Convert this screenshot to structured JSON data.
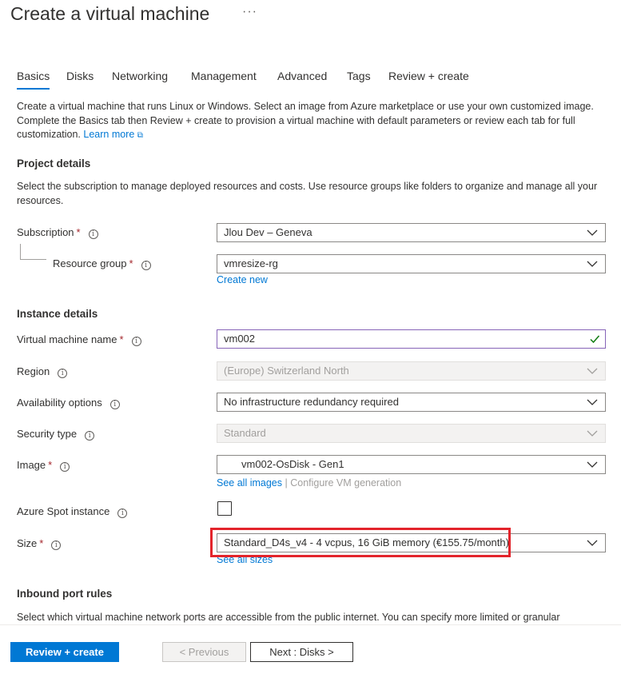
{
  "page": {
    "title": "Create a virtual machine",
    "more_glyph": "···"
  },
  "tabs": [
    "Basics",
    "Disks",
    "Networking",
    "Management",
    "Advanced",
    "Tags",
    "Review + create"
  ],
  "intro": {
    "text": "Create a virtual machine that runs Linux or Windows. Select an image from Azure marketplace or use your own customized image. Complete the Basics tab then Review + create to provision a virtual machine with default parameters or review each tab for full customization. ",
    "learn_more": "Learn more",
    "external_glyph": "⧉"
  },
  "project_details": {
    "heading": "Project details",
    "description": "Select the subscription to manage deployed resources and costs. Use resource groups like folders to organize and manage all your resources.",
    "subscription": {
      "label": "Subscription",
      "value": "Jlou Dev – Geneva"
    },
    "resource_group": {
      "label": "Resource group",
      "value": "vmresize-rg",
      "create_new": "Create new"
    }
  },
  "instance_details": {
    "heading": "Instance details",
    "vm_name": {
      "label": "Virtual machine name",
      "value": "vm002"
    },
    "region": {
      "label": "Region",
      "value": "(Europe) Switzerland North"
    },
    "availability": {
      "label": "Availability options",
      "value": "No infrastructure redundancy required"
    },
    "security_type": {
      "label": "Security type",
      "value": "Standard"
    },
    "image": {
      "label": "Image",
      "value": "vm002-OsDisk - Gen1",
      "see_all": "See all images",
      "separator": "|",
      "configure": "Configure VM generation"
    },
    "spot": {
      "label": "Azure Spot instance",
      "checked": false
    },
    "size": {
      "label": "Size",
      "value": "Standard_D4s_v4 - 4 vcpus, 16 GiB memory (€155.75/month)",
      "see_all": "See all sizes"
    }
  },
  "inbound": {
    "heading": "Inbound port rules",
    "description": "Select which virtual machine network ports are accessible from the public internet. You can specify more limited or granular"
  },
  "glyphs": {
    "required": "*",
    "info": "i"
  },
  "footer": {
    "review_create": "Review + create",
    "previous": "< Previous",
    "next": "Next : Disks >"
  },
  "colors": {
    "accent": "#0078d4",
    "highlight": "#e3242b",
    "required": "#a4262c"
  }
}
